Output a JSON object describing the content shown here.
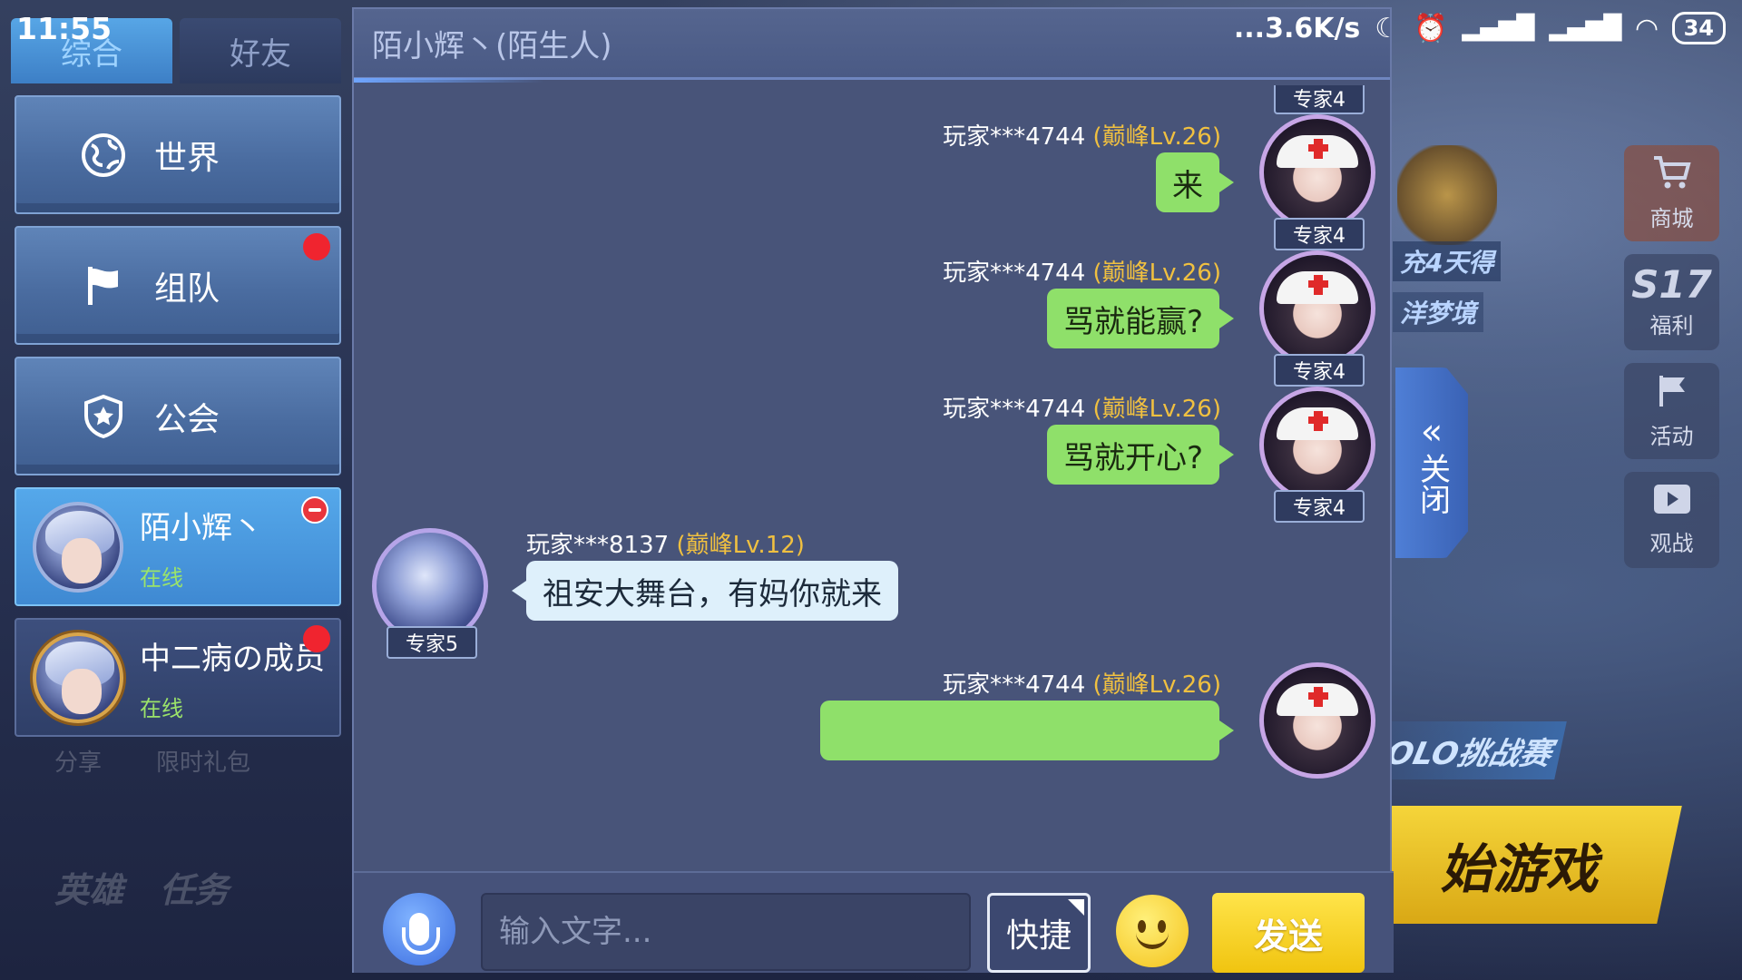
{
  "status_bar": {
    "time": "11:55",
    "net_speed": "...3.6K/s",
    "battery": "34"
  },
  "sidebar": {
    "tabs": [
      {
        "label": "综合",
        "active": true
      },
      {
        "label": "好友",
        "active": false
      }
    ],
    "channels": [
      {
        "label": "世界",
        "icon": "globe-icon"
      },
      {
        "label": "组队",
        "icon": "flag-icon",
        "badge": true
      },
      {
        "label": "公会",
        "icon": "shield-icon"
      }
    ],
    "contacts": [
      {
        "name": "陌小辉丶",
        "status": "在线",
        "active": true
      },
      {
        "name": "中二病の成员",
        "status": "在线",
        "active": false
      }
    ]
  },
  "chat": {
    "title": "陌小辉丶(陌生人)",
    "top_partial_rank": "专家4",
    "messages": [
      {
        "sender": "玩家***4744",
        "rank": "(巅峰Lv.26)",
        "text": "来",
        "badge": "专家4",
        "mine": true
      },
      {
        "sender": "玩家***4744",
        "rank": "(巅峰Lv.26)",
        "text": "骂就能赢?",
        "badge": "专家4",
        "mine": true
      },
      {
        "sender": "玩家***4744",
        "rank": "(巅峰Lv.26)",
        "text": "骂就开心?",
        "badge": "专家4",
        "mine": true
      },
      {
        "sender": "玩家***8137",
        "rank": "(巅峰Lv.12)",
        "text": "祖安大舞台，有妈你就来",
        "badge": "专家5",
        "mine": false
      },
      {
        "sender": "玩家***4744",
        "rank": "(巅峰Lv.26)",
        "text": "",
        "badge": "",
        "mine": true
      }
    ],
    "input_placeholder": "输入文字...",
    "quick_label": "快捷",
    "send_label": "发送"
  },
  "right_panel": {
    "close_label": "关闭",
    "rail": [
      {
        "label": "商城",
        "icon": "cart-icon"
      },
      {
        "label": "福利",
        "icon": "gift-icon"
      },
      {
        "label": "活动",
        "icon": "flag-icon"
      },
      {
        "label": "观战",
        "icon": "play-icon"
      }
    ],
    "promo1": "充4天得",
    "promo2": "洋梦境",
    "solo": "OLO挑战赛",
    "start": "始游戏"
  },
  "background_left": {
    "row1": [
      "分享",
      "限时礼包"
    ],
    "row2": [
      "英雄",
      "任务"
    ]
  }
}
